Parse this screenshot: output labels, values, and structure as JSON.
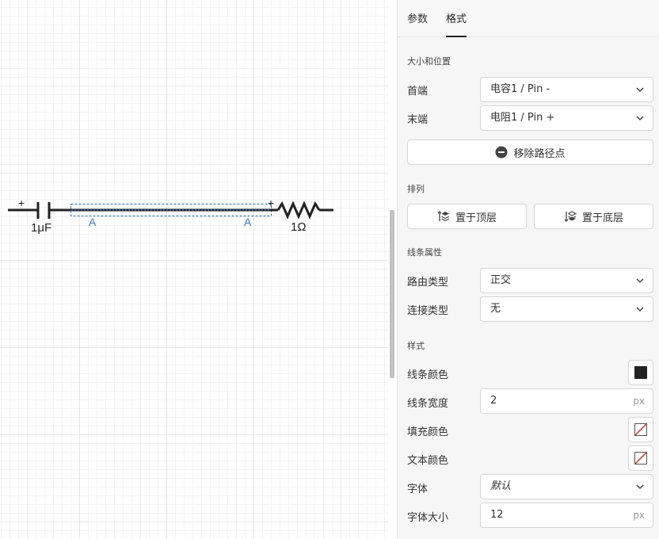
{
  "canvas": {
    "capacitor_label": "1μF",
    "resistor_label": "1Ω",
    "plus_left": "+",
    "plus_right": "+",
    "wire_label_start": "A",
    "wire_label_end": "A"
  },
  "panel": {
    "tabs": [
      {
        "label": "参数",
        "active": false
      },
      {
        "label": "格式",
        "active": true
      }
    ],
    "size_position": {
      "title": "大小和位置",
      "start_label": "首端",
      "start_value": "电容1 / Pin -",
      "end_label": "末端",
      "end_value": "电阻1 / Pin +",
      "remove_waypoints_label": "移除路径点"
    },
    "arrange": {
      "title": "排列",
      "bring_front_label": "置于顶层",
      "send_back_label": "置于底层"
    },
    "line_props": {
      "title": "线条属性",
      "routing_label": "路由类型",
      "routing_value": "正交",
      "connection_label": "连接类型",
      "connection_value": "无"
    },
    "style": {
      "title": "样式",
      "line_color_label": "线条颜色",
      "line_color": "#222222",
      "line_width_label": "线条宽度",
      "line_width_value": "2",
      "line_width_unit": "px",
      "fill_color_label": "填充颜色",
      "text_color_label": "文本颜色",
      "font_label": "字体",
      "font_value": "默认",
      "font_size_label": "字体大小",
      "font_size_value": "12",
      "font_size_unit": "px"
    }
  },
  "colors": {
    "wire": "#222222",
    "selection": "#2b6cb0",
    "no_color_slash": "#c0392b"
  }
}
